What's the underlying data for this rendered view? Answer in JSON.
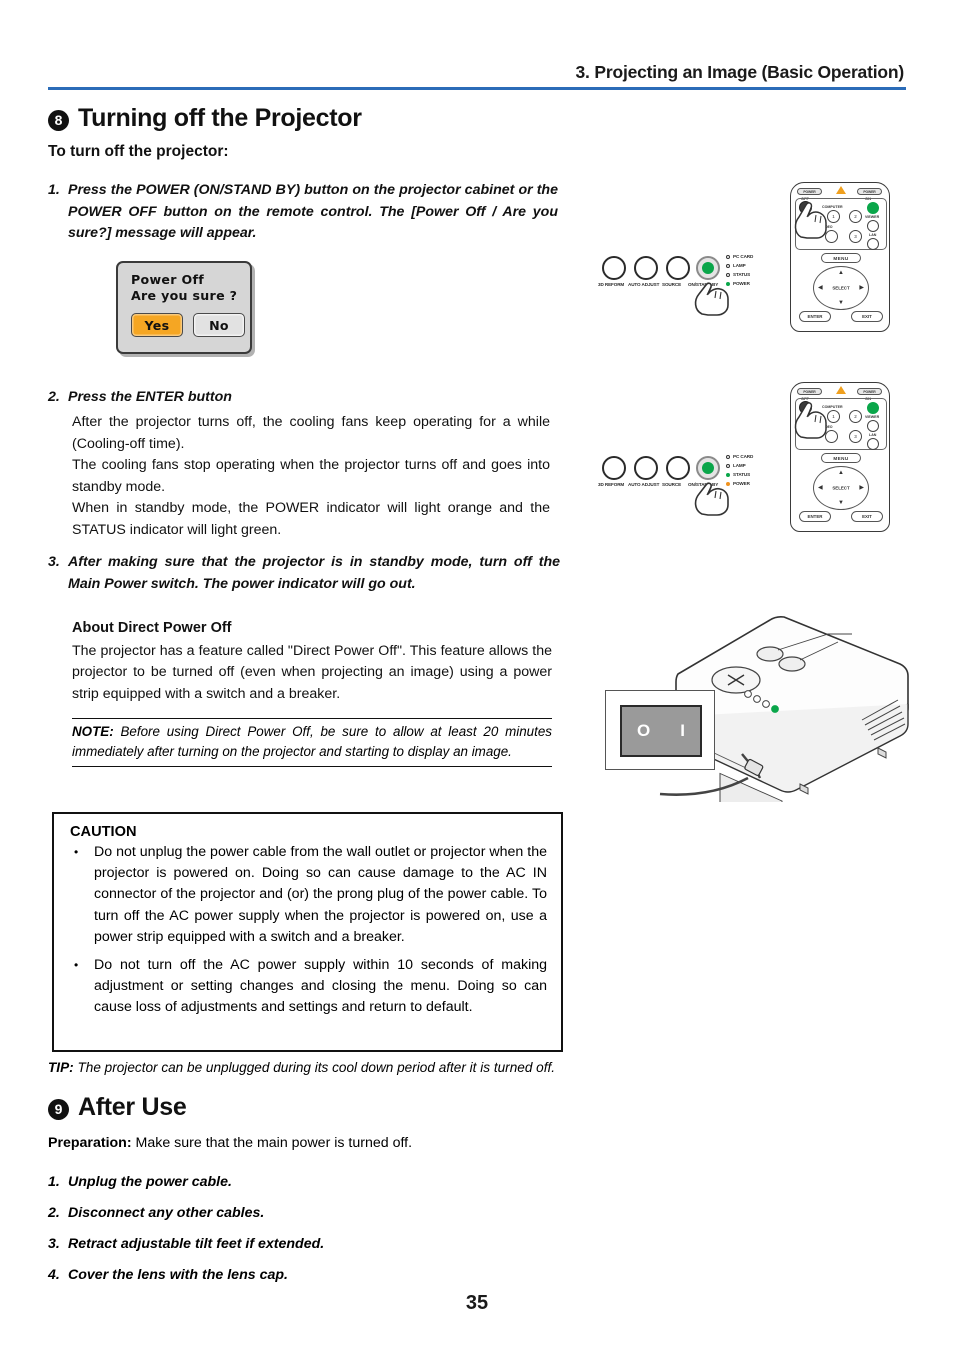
{
  "header": {
    "chapter_title": "3. Projecting an Image (Basic Operation)",
    "rule_color": "#2b6cb8"
  },
  "section8": {
    "number": "8",
    "title": "Turning off the Projector",
    "subhead": "To turn off the projector:",
    "step1": {
      "num": "1.",
      "text": "Press the POWER (ON/STAND BY) button on the projector cabinet or the POWER OFF button on the remote control. The [Power Off / Are you sure?] message will appear."
    },
    "step2": {
      "num": "2.",
      "title": "Press the ENTER button",
      "body_lines": [
        "After the projector turns off, the cooling fans keep operating for a while (Cooling-off time).",
        "The cooling fans stop operating when the projector turns off and goes into standby mode.",
        "When in standby mode, the POWER indicator will light orange and the STATUS indicator will light green."
      ]
    },
    "step3": {
      "num": "3.",
      "text": "After making sure that the projector is in standby mode, turn off the Main Power switch. The power indicator will go out."
    },
    "direct_power_off": {
      "heading": "About Direct Power Off",
      "text": "The projector has a feature called \"Direct Power Off\". This feature allows the projector to be turned off (even when projecting an image) using a power strip equipped with a switch and a breaker.",
      "note_label": "NOTE:",
      "note_text": " Before using Direct Power Off, be sure to allow at least 20 minutes immediately after turning on the projector and starting to display an image."
    }
  },
  "dialog": {
    "line1": "Power Off",
    "line2": "Are you sure ?",
    "yes_label": "Yes",
    "no_label": "No",
    "yes_color": "#f5a623",
    "no_color": "#e2e2e2",
    "background": "#d6d6d6"
  },
  "caution": {
    "title": "CAUTION",
    "items": [
      "Do not unplug the power cable from the wall outlet or projector when the projector is powered on. Doing so can cause damage to the AC IN connector of the projector and (or) the prong plug of the power cable. To turn off the AC power supply when the projector is powered on, use a power strip equipped with a switch and a breaker.",
      "Do not turn off the AC power supply within 10 seconds of making adjustment or setting changes and closing the menu. Doing so can cause loss of adjustments and settings and return to default."
    ],
    "bullet": "•"
  },
  "tip": {
    "label": "TIP:",
    "text": " The projector can be unplugged during its cool down period after it is turned off."
  },
  "section9": {
    "number": "9",
    "title": "After Use",
    "preparation_label": "Preparation:",
    "preparation_text": " Make sure that the main power is turned off.",
    "items": [
      {
        "num": "1.",
        "text": "Unplug the power cable."
      },
      {
        "num": "2.",
        "text": "Disconnect any other cables."
      },
      {
        "num": "3.",
        "text": "Retract adjustable tilt feet if extended."
      },
      {
        "num": "4.",
        "text": "Cover the lens with the lens cap."
      }
    ]
  },
  "illustrations": {
    "control_panel": {
      "buttons": [
        "3D REFORM",
        "AUTO ADJUST",
        "SOURCE",
        "ON/STAND BY"
      ],
      "power_button_label": "ON/STAND BY",
      "indicators": [
        "PC CARD",
        "LAMP",
        "STATUS",
        "POWER"
      ],
      "panel1_power_led_color": "#0aa64a",
      "panel2_power_led_color": "#f0921e",
      "panel2_status_led_color": "#0aa64a"
    },
    "remote": {
      "power_off_label": "POWER",
      "power_off_sub": "OFF",
      "power_on_label": "POWER",
      "power_on_sub": "ON",
      "group_label": "COMPUTER",
      "computer_buttons": [
        "1",
        "2",
        "3"
      ],
      "viewer_label": "VIEWER",
      "lan_label": "LAN",
      "video_label": "VIDEO",
      "menu_label": "MENU",
      "select_label": "SELECT",
      "enter_label": "ENTER",
      "exit_label": "EXIT"
    },
    "main_power_switch": {
      "off_symbol": "O",
      "on_symbol": "I"
    }
  },
  "page_number": "35"
}
